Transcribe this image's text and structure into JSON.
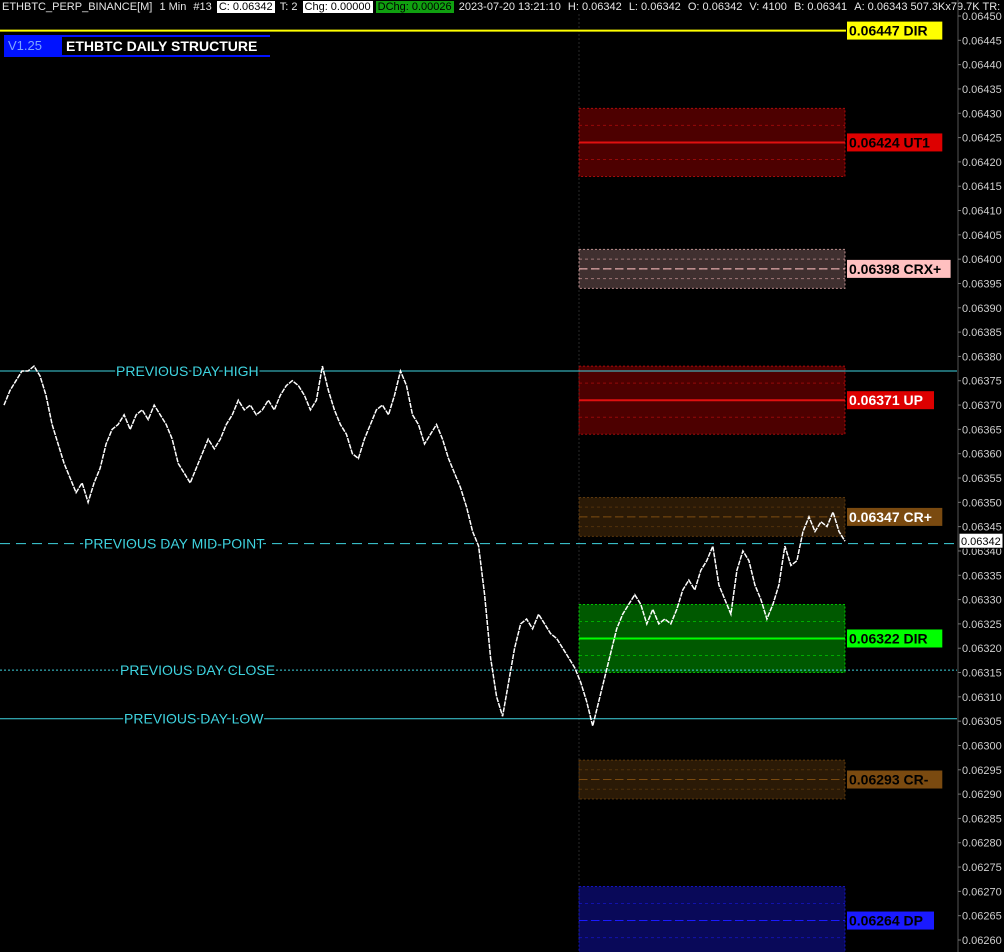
{
  "header": {
    "symbol": "ETHBTC_PERP_BINANCE[M]",
    "timeframe": "1 Min",
    "bar_num": "#13",
    "close": "C: 0.06342",
    "trades": "T: 2",
    "chg": "Chg: 0.00000",
    "dchg": "DChg: 0.00026",
    "datetime": "2023-07-20 13:21:10",
    "high": "H: 0.06342",
    "low": "L: 0.06342",
    "open": "O: 0.06342",
    "volume": "V: 4100",
    "bid": "B: 0.06341",
    "ask": "A: 0.06343 507.3Kx79.7K TR:"
  },
  "study": {
    "version": "V1.25",
    "title": "ETHBTC DAILY STRUCTURE"
  },
  "colors": {
    "background": "#000000",
    "price_line": "#ffffff",
    "cyan": "#3fd4e0",
    "dir_yellow": "#ffff00",
    "ut1_red": "#e01010",
    "crx_pink": "#ffc0c0",
    "up_red": "#e01010",
    "cr_plus_brown": "#7a4a10",
    "dir_green": "#00ff00",
    "cr_minus_brown": "#7a4a10",
    "dp_blue": "#1a1aff"
  },
  "chart_data": {
    "type": "line",
    "title": "ETHBTC DAILY STRUCTURE",
    "ylim": [
      0.06257,
      0.06452
    ],
    "y_ticks": [
      "0.06450",
      "0.06445",
      "0.06440",
      "0.06435",
      "0.06430",
      "0.06425",
      "0.06420",
      "0.06415",
      "0.06410",
      "0.06405",
      "0.06400",
      "0.06395",
      "0.06390",
      "0.06385",
      "0.06380",
      "0.06375",
      "0.06370",
      "0.06365",
      "0.06360",
      "0.06355",
      "0.06350",
      "0.06345",
      "0.06340",
      "0.06335",
      "0.06330",
      "0.06325",
      "0.06320",
      "0.06315",
      "0.06310",
      "0.06305",
      "0.06300",
      "0.06295",
      "0.06290",
      "0.06285",
      "0.06280",
      "0.06275",
      "0.06270",
      "0.06265",
      "0.06260"
    ],
    "current_price": "0.06342",
    "price_path": [
      0.0637,
      0.06373,
      0.06375,
      0.06377,
      0.06377,
      0.06378,
      0.06376,
      0.06372,
      0.06366,
      0.06362,
      0.06358,
      0.06355,
      0.06352,
      0.06354,
      0.0635,
      0.06354,
      0.06357,
      0.06362,
      0.06365,
      0.06366,
      0.06368,
      0.06365,
      0.06368,
      0.06369,
      0.06367,
      0.0637,
      0.06368,
      0.06366,
      0.06363,
      0.06358,
      0.06356,
      0.06354,
      0.06357,
      0.0636,
      0.06363,
      0.06361,
      0.06363,
      0.06366,
      0.06368,
      0.06371,
      0.06369,
      0.0637,
      0.06368,
      0.06369,
      0.06371,
      0.06369,
      0.06372,
      0.06374,
      0.06375,
      0.06374,
      0.06372,
      0.06369,
      0.06371,
      0.06378,
      0.06373,
      0.06369,
      0.06366,
      0.06364,
      0.0636,
      0.06359,
      0.06363,
      0.06366,
      0.06369,
      0.0637,
      0.06368,
      0.06372,
      0.06377,
      0.06374,
      0.06368,
      0.06366,
      0.06362,
      0.06364,
      0.06366,
      0.06363,
      0.06359,
      0.06356,
      0.06353,
      0.06349,
      0.06344,
      0.06341,
      0.06331,
      0.06318,
      0.0631,
      0.06306,
      0.06313,
      0.0632,
      0.06325,
      0.06326,
      0.06324,
      0.06327,
      0.06325,
      0.06323,
      0.06322,
      0.0632,
      0.06318,
      0.06316,
      0.06313,
      0.06309,
      0.06304,
      0.06309,
      0.06314,
      0.06319,
      0.06324,
      0.06327,
      0.06329,
      0.06331,
      0.06329,
      0.06325,
      0.06328,
      0.06325,
      0.06326,
      0.06325,
      0.06328,
      0.06332,
      0.06334,
      0.06332,
      0.06336,
      0.06338,
      0.06341,
      0.06333,
      0.0633,
      0.06327,
      0.06336,
      0.0634,
      0.06338,
      0.06333,
      0.0633,
      0.06326,
      0.06329,
      0.06333,
      0.06341,
      0.06337,
      0.06338,
      0.06344,
      0.06347,
      0.06344,
      0.06346,
      0.06345,
      0.06348,
      0.06344,
      0.06342
    ],
    "reference_lines": [
      {
        "label": "PREVIOUS DAY HIGH",
        "value": 0.06377,
        "style": "solid"
      },
      {
        "label": "PREVIOUS DAY MID-POINT",
        "value": 0.063415,
        "style": "dashed"
      },
      {
        "label": "PREVIOUS DAY CLOSE",
        "value": 0.063155,
        "style": "dotted"
      },
      {
        "label": "PREVIOUS DAY LOW",
        "value": 0.063055,
        "style": "solid"
      }
    ],
    "levels": [
      {
        "label": "0.06447 DIR",
        "value": 0.06447,
        "zone": null,
        "color": "#ffff00",
        "fill": "#ffff00",
        "text": "#000000"
      },
      {
        "label": "0.06424 UT1",
        "value": 0.06424,
        "zone": [
          0.06417,
          0.06431
        ],
        "color": "#e01010",
        "fill": "#dd0000",
        "text": "#000000"
      },
      {
        "label": "0.06398 CRX+",
        "value": 0.06398,
        "zone": [
          0.06394,
          0.06402
        ],
        "color": "#ffc0c0",
        "fill": "#ffc0c0",
        "text": "#000000"
      },
      {
        "label": "0.06371 UP",
        "value": 0.06371,
        "zone": [
          0.06364,
          0.06378
        ],
        "color": "#e01010",
        "fill": "#dd0000",
        "text": "#ffffff"
      },
      {
        "label": "0.06347 CR+",
        "value": 0.06347,
        "zone": [
          0.06343,
          0.06351
        ],
        "color": "#7a4a10",
        "fill": "#7a4a10",
        "text": "#ffffff"
      },
      {
        "label": "0.06322 DIR",
        "value": 0.06322,
        "zone": [
          0.06315,
          0.06329
        ],
        "color": "#00ff00",
        "fill": "#00ff00",
        "text": "#000000"
      },
      {
        "label": "0.06293 CR-",
        "value": 0.06293,
        "zone": [
          0.06289,
          0.06297
        ],
        "color": "#7a4a10",
        "fill": "#7a4a10",
        "text": "#000000"
      },
      {
        "label": "0.06264 DP",
        "value": 0.06264,
        "zone": [
          0.06257,
          0.06271
        ],
        "color": "#1a1aff",
        "fill": "#1a1aff",
        "text": "#000000"
      }
    ]
  }
}
